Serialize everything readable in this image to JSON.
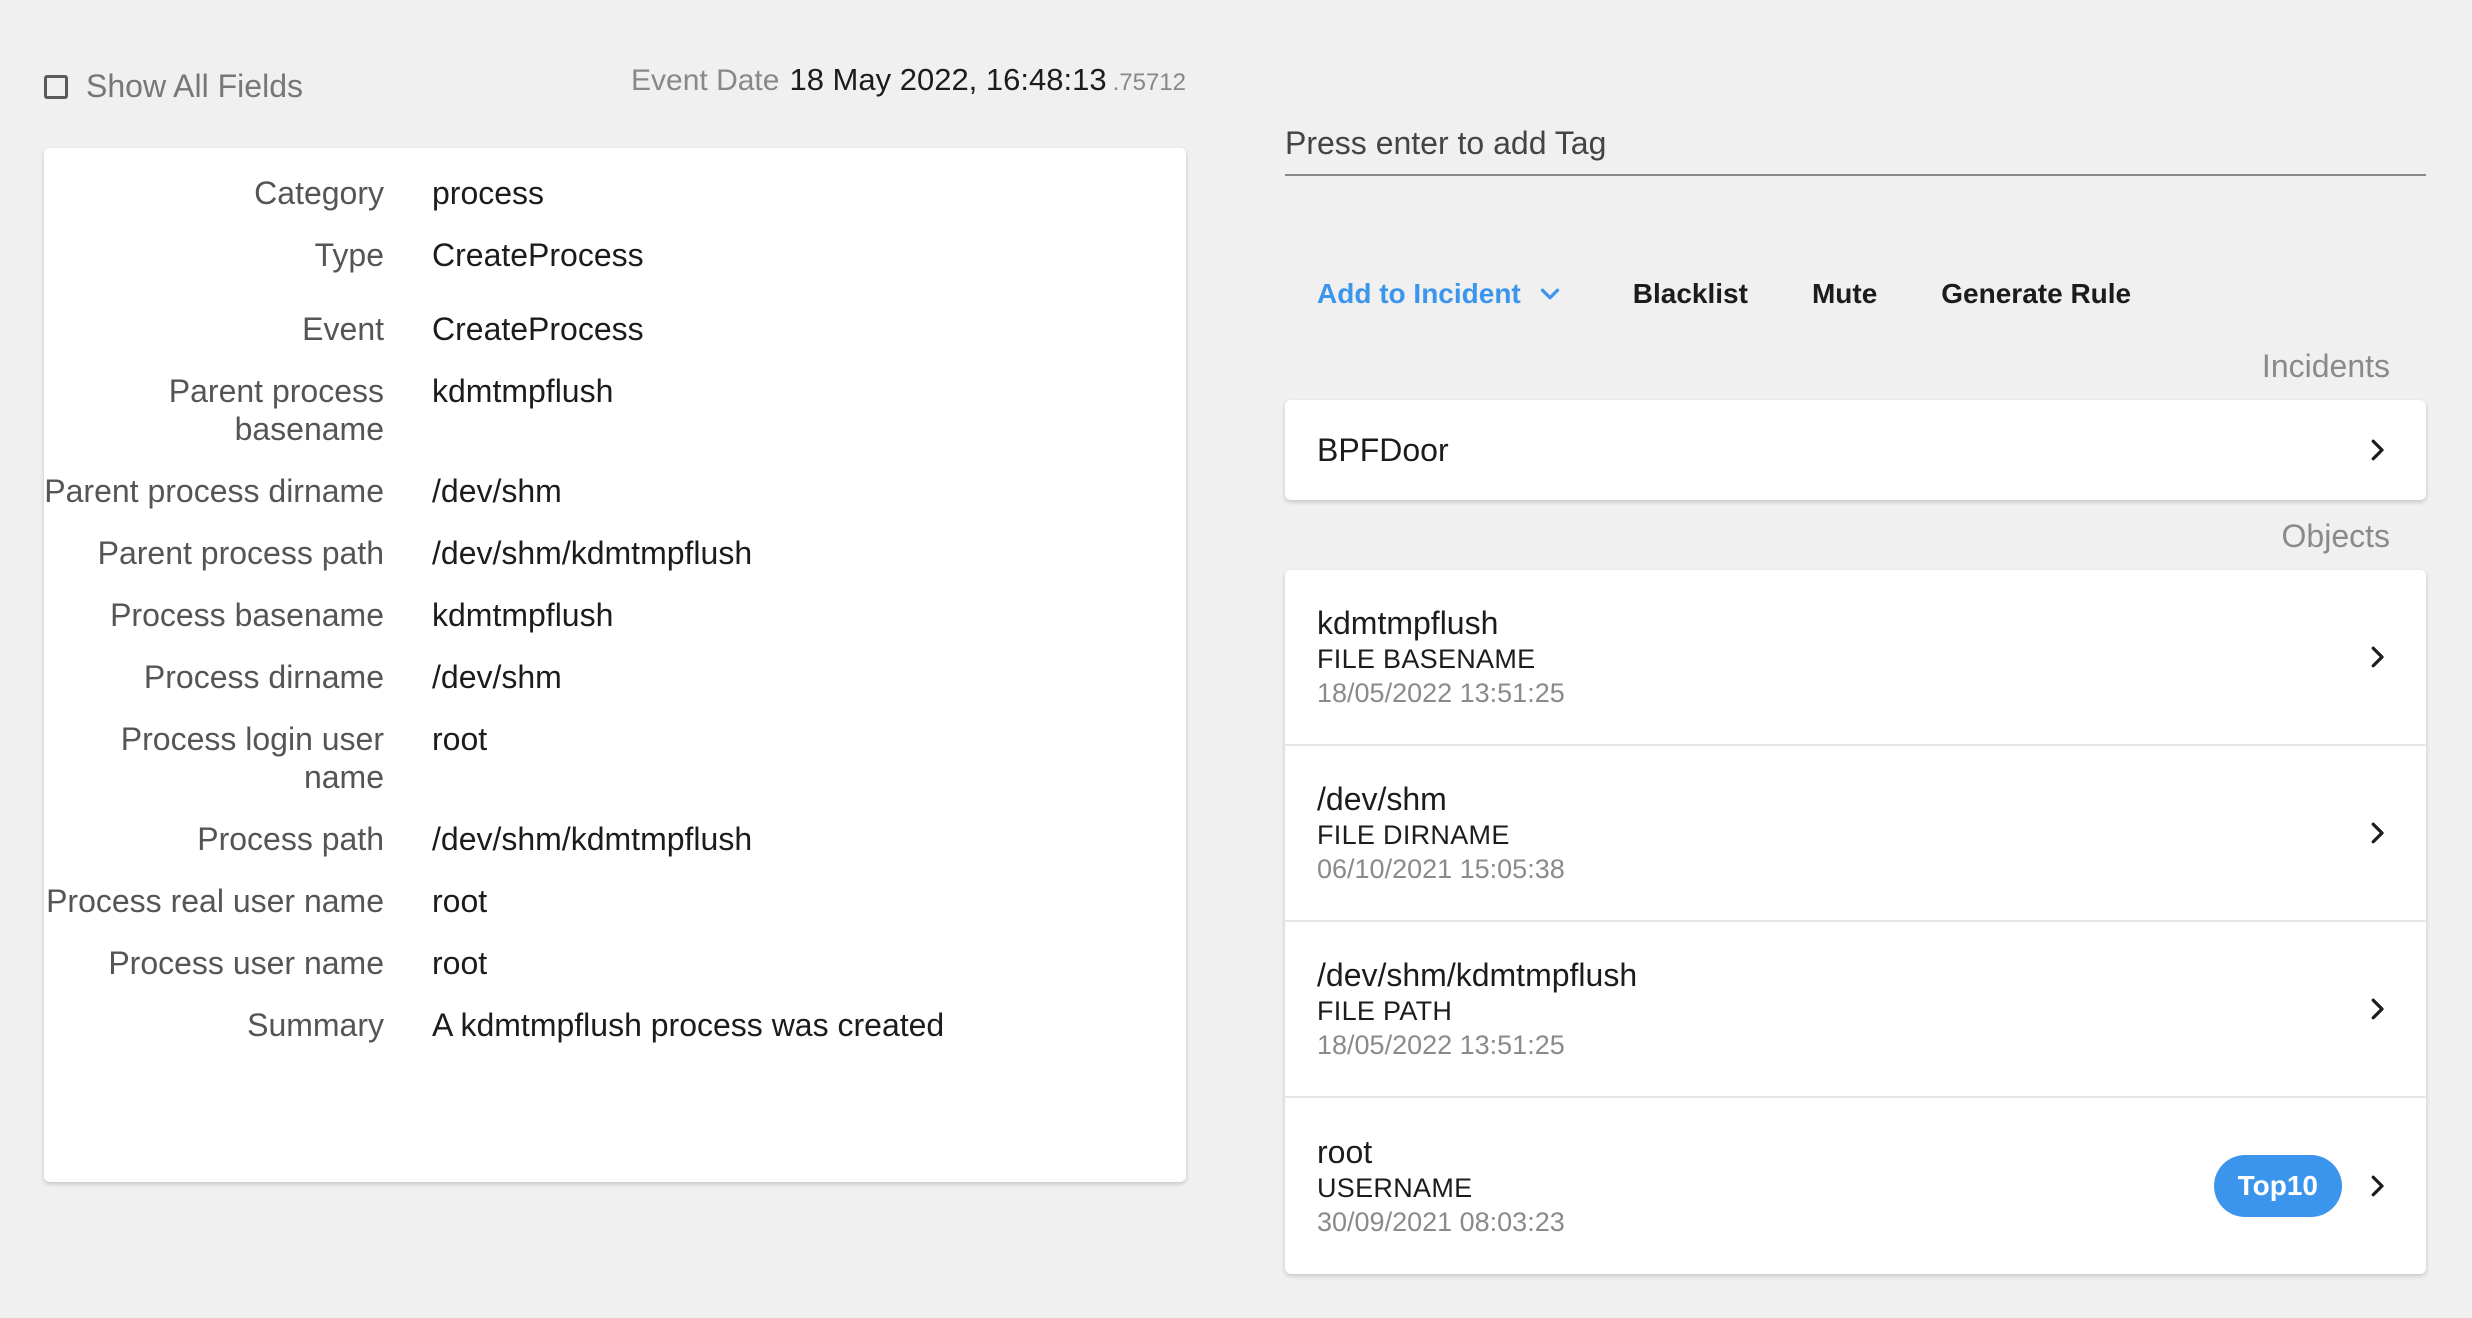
{
  "header": {
    "show_all_fields_label": "Show All Fields",
    "event_date_label": "Event Date",
    "event_date_value": "18 May 2022, 16:48:13",
    "event_date_ms": ".75712"
  },
  "fields": [
    {
      "key": "Category",
      "value": "process"
    },
    {
      "key": "Type",
      "value": "CreateProcess"
    },
    {
      "key": "Event",
      "value": "CreateProcess"
    },
    {
      "key": "Parent process basename",
      "value": "kdmtmpflush"
    },
    {
      "key": "Parent process dirname",
      "value": "/dev/shm"
    },
    {
      "key": "Parent process path",
      "value": "/dev/shm/kdmtmpflush"
    },
    {
      "key": "Process basename",
      "value": "kdmtmpflush"
    },
    {
      "key": "Process dirname",
      "value": "/dev/shm"
    },
    {
      "key": "Process login user name",
      "value": "root"
    },
    {
      "key": "Process path",
      "value": "/dev/shm/kdmtmpflush"
    },
    {
      "key": "Process real user name",
      "value": "root"
    },
    {
      "key": "Process user name",
      "value": "root"
    },
    {
      "key": "Summary",
      "value": "A kdmtmpflush process was created"
    }
  ],
  "tag_input": {
    "placeholder": "Press enter to add Tag",
    "value": ""
  },
  "actions": {
    "add_to_incident": "Add to Incident",
    "blacklist": "Blacklist",
    "mute": "Mute",
    "generate_rule": "Generate Rule"
  },
  "incidents": {
    "label": "Incidents",
    "items": [
      {
        "name": "BPFDoor"
      }
    ]
  },
  "objects": {
    "label": "Objects",
    "items": [
      {
        "name": "kdmtmpflush",
        "type": "FILE BASENAME",
        "date": "18/05/2022 13:51:25",
        "badge": ""
      },
      {
        "name": "/dev/shm",
        "type": "FILE DIRNAME",
        "date": "06/10/2021 15:05:38",
        "badge": ""
      },
      {
        "name": "/dev/shm/kdmtmpflush",
        "type": "FILE PATH",
        "date": "18/05/2022 13:51:25",
        "badge": ""
      },
      {
        "name": "root",
        "type": "USERNAME",
        "date": "30/09/2021 08:03:23",
        "badge": "Top10"
      }
    ]
  },
  "colors": {
    "accent": "#3b95ec",
    "background": "#f0f0f0",
    "card": "#ffffff"
  }
}
